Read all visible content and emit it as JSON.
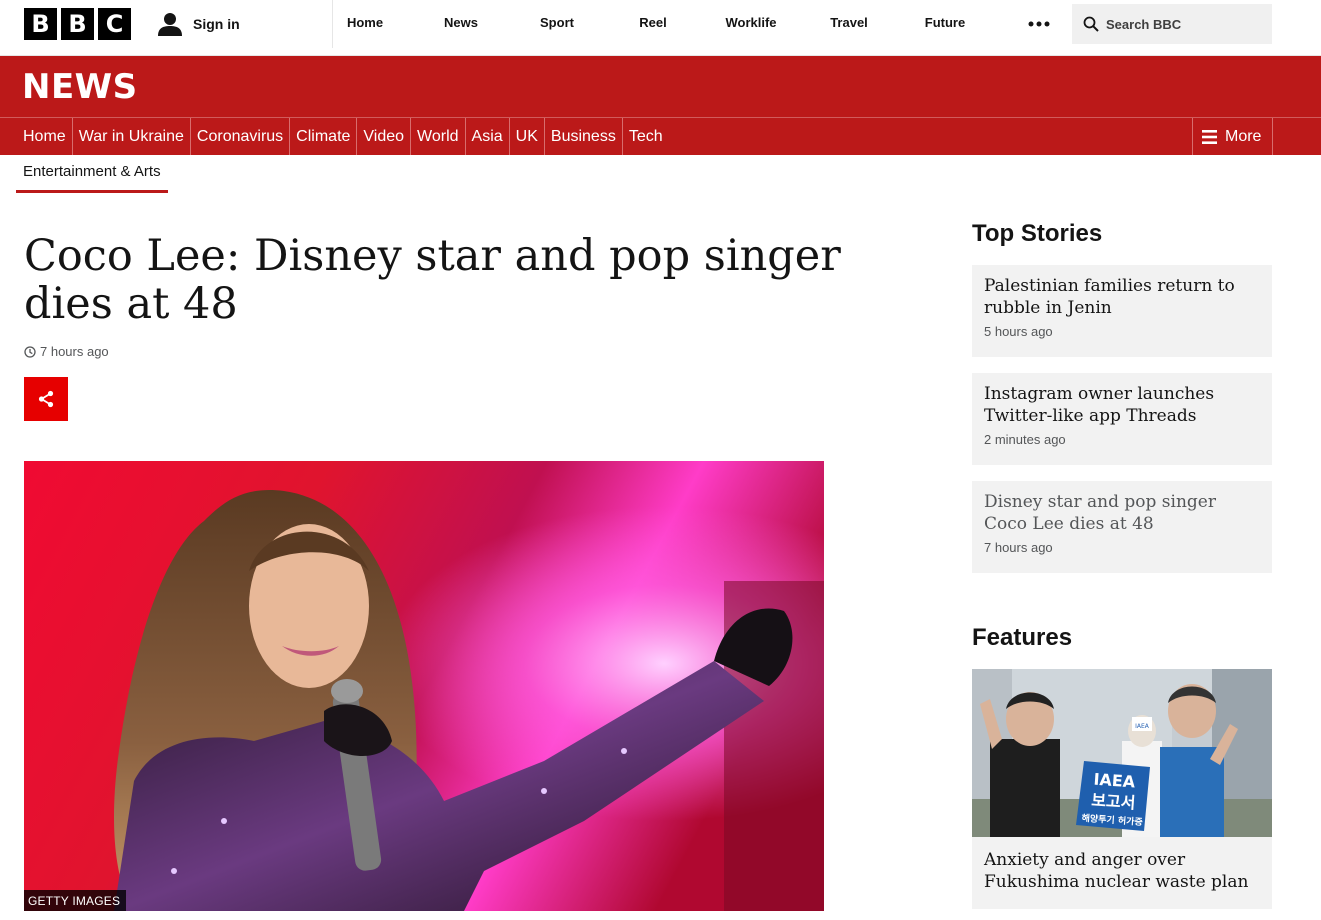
{
  "bbc": {
    "logo_letters": [
      "B",
      "B",
      "C"
    ],
    "sign_in": "Sign in",
    "nav": [
      "Home",
      "News",
      "Sport",
      "Reel",
      "Worklife",
      "Travel",
      "Future"
    ],
    "search_placeholder": "Search BBC"
  },
  "news": {
    "wordmark": "NEWS",
    "sections": [
      "Home",
      "War in Ukraine",
      "Coronavirus",
      "Climate",
      "Video",
      "World",
      "Asia",
      "UK",
      "Business",
      "Tech"
    ],
    "more_label": "More",
    "subsection": "Entertainment & Arts"
  },
  "article": {
    "headline": "Coco Lee: Disney star and pop singer dies at 48",
    "timestamp": "7 hours ago",
    "image_credit": "GETTY IMAGES"
  },
  "sidebar": {
    "top_stories_heading": "Top Stories",
    "top_stories": [
      {
        "title": "Palestinian families return to rubble in Jenin",
        "time": "5 hours ago"
      },
      {
        "title": "Instagram owner launches Twitter-like app Threads",
        "time": "2 minutes ago"
      },
      {
        "title": "Disney star and pop singer Coco Lee dies at 48",
        "time": "7 hours ago"
      }
    ],
    "features_heading": "Features",
    "feature": {
      "title": "Anxiety and anger over Fukushima nuclear waste plan",
      "sign_lines": [
        "IAEA",
        "보고서",
        "해양투기 허가증"
      ],
      "small_badge": "IAEA"
    }
  },
  "colors": {
    "news_red": "#bb1919",
    "share_red": "#e60000"
  }
}
